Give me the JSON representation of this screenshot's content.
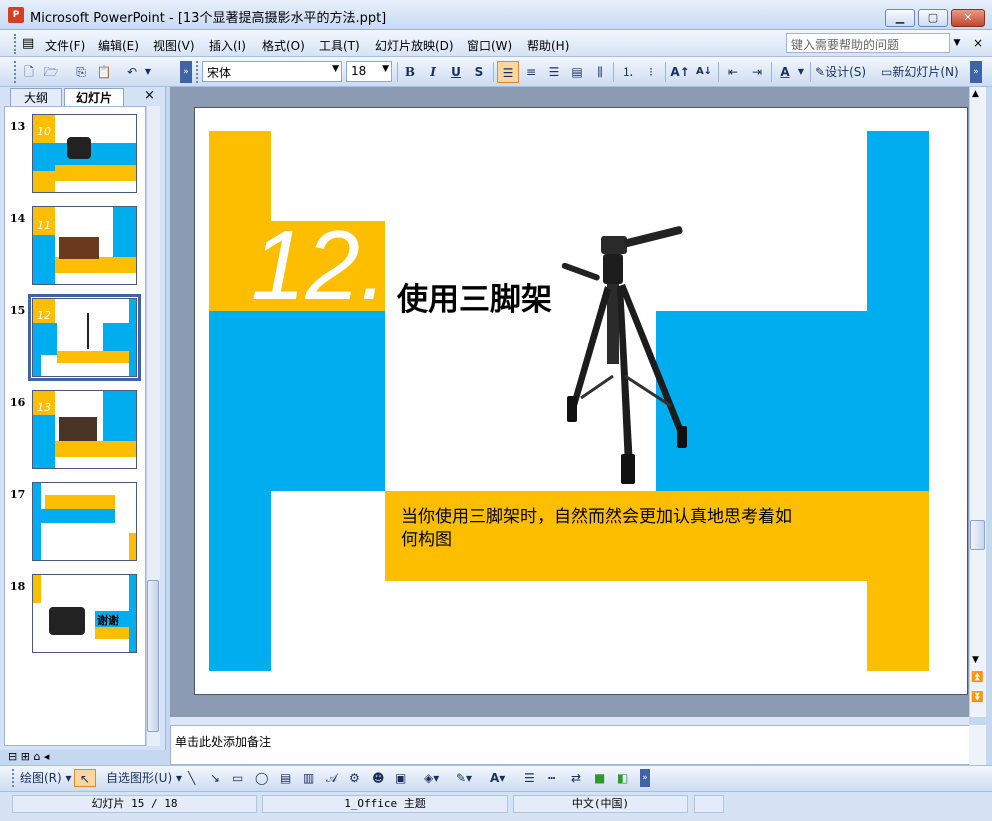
{
  "window": {
    "app_icon": "P",
    "title": "Microsoft PowerPoint - [13个显著提高摄影水平的方法.ppt]",
    "buttons": {
      "minimize": "▁",
      "maximize": "▢",
      "close": "✕"
    }
  },
  "menu": {
    "items": [
      "文件(F)",
      "编辑(E)",
      "视图(V)",
      "插入(I)",
      "格式(O)",
      "工具(T)",
      "幻灯片放映(D)",
      "窗口(W)",
      "帮助(H)"
    ],
    "help_placeholder": "键入需要帮助的问题",
    "doc_close": "×"
  },
  "toolbar": {
    "font_name": "宋体",
    "font_size": "18",
    "bold": "B",
    "italic": "I",
    "underline": "U",
    "shadow": "S",
    "design_label": "设计(S)",
    "new_slide_label": "新幻灯片(N)"
  },
  "left_panel": {
    "tabs": [
      "大纲",
      "幻灯片"
    ],
    "close": "×",
    "thumbnails": [
      {
        "number": "13",
        "badge": "10"
      },
      {
        "number": "14",
        "badge": "11"
      },
      {
        "number": "15",
        "badge": "12"
      },
      {
        "number": "16",
        "badge": "13"
      },
      {
        "number": "17",
        "badge": ""
      },
      {
        "number": "18",
        "badge": "",
        "word": "谢谢"
      }
    ],
    "selected_index": 2
  },
  "slide": {
    "number": "12.",
    "title": "使用三脚架",
    "body": "当你使用三脚架时，自然而然会更加认真地思考着如何构图",
    "colors": {
      "yellow": "#fdbe00",
      "blue": "#00aeef"
    }
  },
  "notes": {
    "placeholder": "单击此处添加备注"
  },
  "drawing": {
    "draw_label": "绘图(R)",
    "autoshape_label": "自选图形(U)"
  },
  "status": {
    "slide_pos": "幻灯片 15 / 18",
    "theme": "1_Office 主题",
    "language": "中文(中国)"
  }
}
